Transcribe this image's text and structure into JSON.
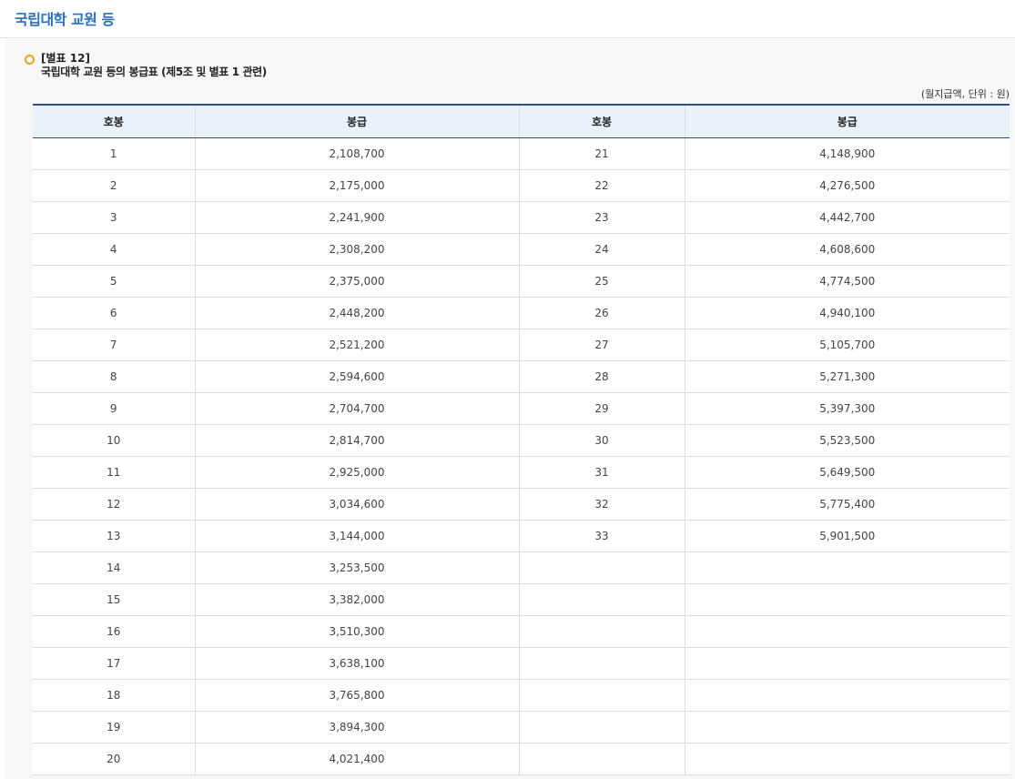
{
  "page": {
    "title": "국립대학 교원 등"
  },
  "caption": {
    "annex": "[별표 12]",
    "title": "국립대학 교원 등의 봉급표 (제5조 및 별표 1 관련)",
    "unit": "(월지급액, 단위 : 원)",
    "bullet_icon": "circle-bullet-icon",
    "bullet_color": "#f0a020"
  },
  "table": {
    "headers": [
      "호봉",
      "봉급",
      "호봉",
      "봉급"
    ],
    "rows": [
      [
        "1",
        "2,108,700",
        "21",
        "4,148,900"
      ],
      [
        "2",
        "2,175,000",
        "22",
        "4,276,500"
      ],
      [
        "3",
        "2,241,900",
        "23",
        "4,442,700"
      ],
      [
        "4",
        "2,308,200",
        "24",
        "4,608,600"
      ],
      [
        "5",
        "2,375,000",
        "25",
        "4,774,500"
      ],
      [
        "6",
        "2,448,200",
        "26",
        "4,940,100"
      ],
      [
        "7",
        "2,521,200",
        "27",
        "5,105,700"
      ],
      [
        "8",
        "2,594,600",
        "28",
        "5,271,300"
      ],
      [
        "9",
        "2,704,700",
        "29",
        "5,397,300"
      ],
      [
        "10",
        "2,814,700",
        "30",
        "5,523,500"
      ],
      [
        "11",
        "2,925,000",
        "31",
        "5,649,500"
      ],
      [
        "12",
        "3,034,600",
        "32",
        "5,775,400"
      ],
      [
        "13",
        "3,144,000",
        "33",
        "5,901,500"
      ],
      [
        "14",
        "3,253,500",
        "",
        ""
      ],
      [
        "15",
        "3,382,000",
        "",
        ""
      ],
      [
        "16",
        "3,510,300",
        "",
        ""
      ],
      [
        "17",
        "3,638,100",
        "",
        ""
      ],
      [
        "18",
        "3,765,800",
        "",
        ""
      ],
      [
        "19",
        "3,894,300",
        "",
        ""
      ],
      [
        "20",
        "4,021,400",
        "",
        ""
      ]
    ]
  },
  "colors": {
    "title": "#2a6fc2",
    "header_bg": "#e9f1fb",
    "header_border": "#2d4f8f"
  }
}
